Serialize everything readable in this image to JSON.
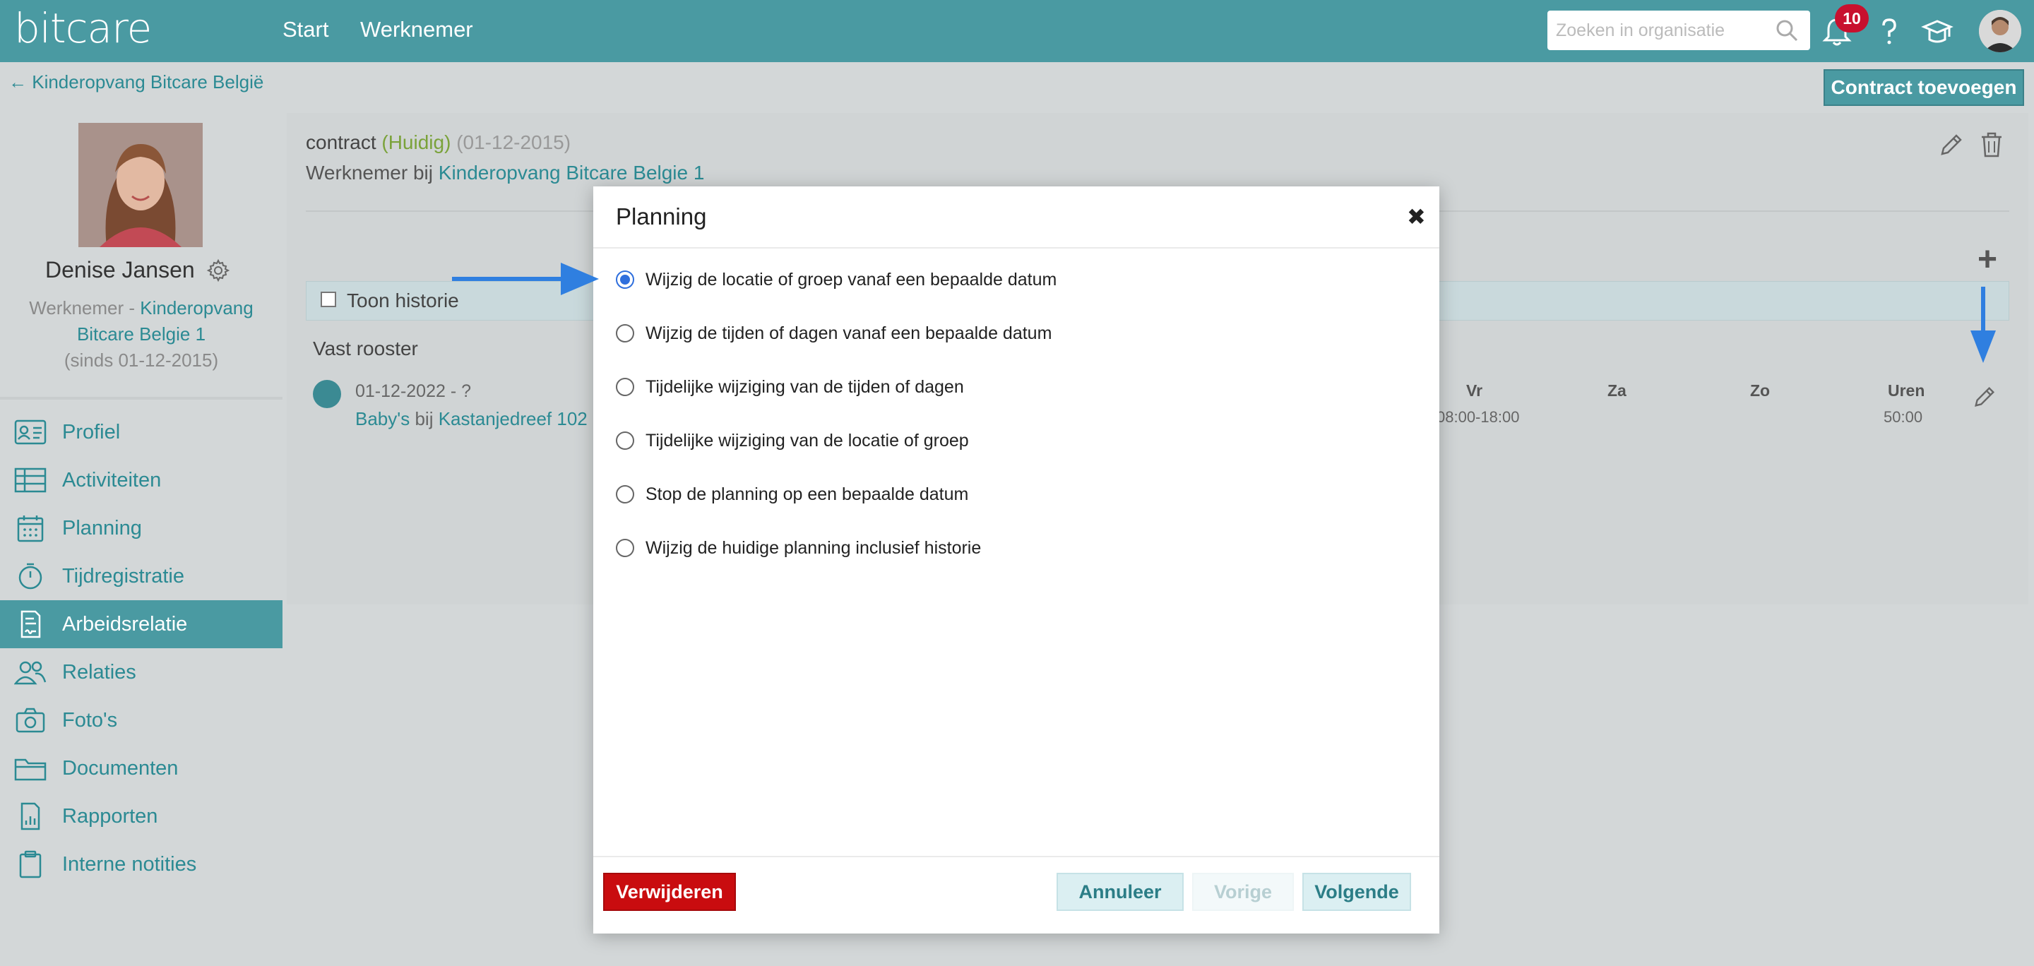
{
  "app": {
    "logo": "bitcare"
  },
  "topnav": {
    "items": [
      "Start",
      "Werknemer"
    ],
    "search_placeholder": "Zoeken in organisatie",
    "notification_count": "10"
  },
  "sidebar": {
    "back_link": "← Kinderopvang Bitcare België",
    "employee_name": "Denise Jansen",
    "role_prefix": "Werknemer - ",
    "org_link": "Kinderopvang Bitcare Belgie 1",
    "since": "(sinds 01-12-2015)",
    "menu": [
      {
        "label": "Profiel",
        "icon": "id-card-icon"
      },
      {
        "label": "Activiteiten",
        "icon": "table-icon"
      },
      {
        "label": "Planning",
        "icon": "calendar-icon"
      },
      {
        "label": "Tijdregistratie",
        "icon": "stopwatch-icon"
      },
      {
        "label": "Arbeidsrelatie",
        "icon": "contract-icon",
        "active": true
      },
      {
        "label": "Relaties",
        "icon": "people-icon"
      },
      {
        "label": "Foto's",
        "icon": "camera-icon"
      },
      {
        "label": "Documenten",
        "icon": "folder-icon"
      },
      {
        "label": "Rapporten",
        "icon": "report-icon"
      },
      {
        "label": "Interne notities",
        "icon": "clipboard-icon"
      }
    ]
  },
  "main": {
    "contract_button": "Contract toevoegen",
    "contract_label": "contract",
    "current_label": "(Huidig)",
    "contract_date": "(01-12-2015)",
    "employee_at_prefix": "Werknemer bij ",
    "employee_at_org": "Kinderopvang Bitcare Belgie 1",
    "show_history": "Toon historie",
    "fixed_schedule": "Vast rooster",
    "row": {
      "date_range": "01-12-2022 - ?",
      "group": "Baby's",
      "bij": " bij ",
      "location": "Kastanjedreef 102 (",
      "days": [
        "Vr",
        "Za",
        "Zo",
        "Uren"
      ],
      "friday_time": "08:00-18:00",
      "hours": "50:00"
    }
  },
  "modal": {
    "title": "Planning",
    "close": "✖",
    "options": [
      {
        "label": "Wijzig de locatie of groep vanaf een bepaalde datum",
        "checked": true
      },
      {
        "label": "Wijzig de tijden of dagen vanaf een bepaalde datum",
        "checked": false
      },
      {
        "label": "Tijdelijke wijziging van de tijden of dagen",
        "checked": false
      },
      {
        "label": "Tijdelijke wijziging van de locatie of groep",
        "checked": false
      },
      {
        "label": "Stop de planning op een bepaalde datum",
        "checked": false
      },
      {
        "label": "Wijzig de huidige planning inclusief historie",
        "checked": false
      }
    ],
    "buttons": {
      "delete": "Verwijderen",
      "cancel": "Annuleer",
      "previous": "Vorige",
      "next": "Volgende"
    }
  },
  "colors": {
    "topbar": "#4a9aa2",
    "link": "#2b8a93",
    "danger": "#c90c0f",
    "annotation_arrow": "#2f7fe0"
  }
}
